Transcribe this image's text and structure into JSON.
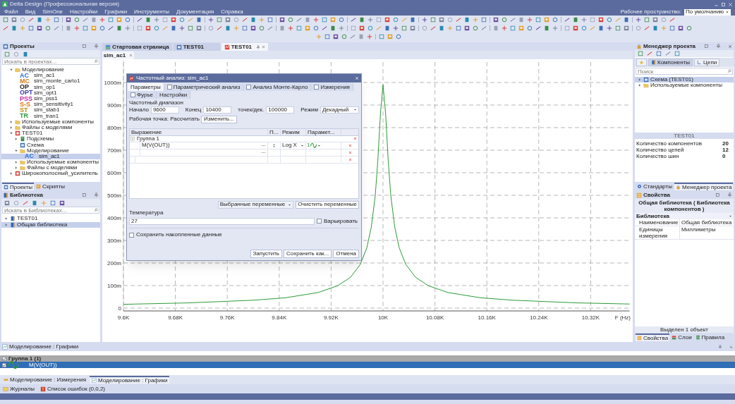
{
  "window": {
    "title": "Delta Design (Профессиональная версия)",
    "workspace_label": "Рабочее пространство:",
    "workspace_value": "По умолчанию"
  },
  "menu": [
    "Файл",
    "Вид",
    "SimOne",
    "Настройки",
    "Графики",
    "Инструменты",
    "Документация",
    "Справка"
  ],
  "projects_panel": {
    "title": "Проекты",
    "search_placeholder": "Искать в проектах...",
    "tree": [
      {
        "label": "Моделирование",
        "kind": "folder",
        "expanded": true,
        "selected": false,
        "children": [
          {
            "label": "sim_ac1",
            "kind": "sim",
            "badge": "AC",
            "color": "#2a6fd0",
            "selected": false
          },
          {
            "label": "sim_monte_carlo1",
            "kind": "sim",
            "badge": "MC",
            "color": "#d07a20",
            "selected": false
          },
          {
            "label": "sim_op1",
            "kind": "sim",
            "badge": "OP",
            "color": "#222222",
            "selected": false
          },
          {
            "label": "sim_opt1",
            "kind": "sim",
            "badge": "OPT",
            "color": "#3a3ab0",
            "selected": false
          },
          {
            "label": "sim_pss1",
            "kind": "sim",
            "badge": "PSS",
            "color": "#c02aa0",
            "selected": false
          },
          {
            "label": "sim_sensitivity1",
            "kind": "sim",
            "badge": "S-S",
            "color": "#e07010",
            "selected": false
          },
          {
            "label": "sim_stab1",
            "kind": "sim",
            "badge": "ST",
            "color": "#c08a10",
            "selected": false
          },
          {
            "label": "sim_tran1",
            "kind": "sim",
            "badge": "TR",
            "color": "#2a9a3a",
            "selected": false
          }
        ]
      },
      {
        "label": "Используемые компоненты",
        "kind": "folder",
        "expanded": false,
        "selected": false
      },
      {
        "label": "Файлы с моделями",
        "kind": "folder",
        "expanded": false,
        "selected": false
      },
      {
        "label": "TEST01",
        "kind": "project",
        "expanded": true,
        "selected": false,
        "children": [
          {
            "label": "Подсхемы",
            "kind": "subcircuit",
            "expanded": false,
            "selected": false
          },
          {
            "label": "Схема",
            "kind": "schematic",
            "selected": false
          },
          {
            "label": "Моделирование",
            "kind": "folder",
            "expanded": true,
            "selected": false,
            "children": [
              {
                "label": "sim_ac1",
                "kind": "sim",
                "badge": "AC",
                "color": "#2a6fd0",
                "selected": true
              }
            ]
          },
          {
            "label": "Используемые компоненты",
            "kind": "folder",
            "expanded": false,
            "selected": false
          },
          {
            "label": "Файлы с моделями",
            "kind": "folder",
            "expanded": false,
            "selected": false
          }
        ]
      },
      {
        "label": "Широкополосный_усилитель",
        "kind": "project",
        "expanded": false,
        "selected": false
      }
    ]
  },
  "left_tabs": [
    {
      "label": "Проекты",
      "kind": "projects",
      "selected": true
    },
    {
      "label": "Скрипты",
      "kind": "scripts",
      "selected": false
    }
  ],
  "library_panel": {
    "title": "Библиотека",
    "search_placeholder": "Искать в Библиотеках...",
    "items": [
      {
        "label": "TEST01",
        "selected": false
      },
      {
        "label": "Общая библиотека",
        "selected": true
      }
    ]
  },
  "document_tabs": [
    {
      "label": "Стартовая страница",
      "kind": "start",
      "selected": false
    },
    {
      "label": "TEST01",
      "kind": "schematic",
      "selected": false
    },
    {
      "label": "TEST01",
      "kind": "sim",
      "selected": true
    }
  ],
  "sub_tabs": [
    {
      "label": "sim_ac1",
      "selected": true
    }
  ],
  "chart": {
    "chart_data": {
      "type": "line",
      "xlabel": "F (Hz)",
      "x": [
        9600,
        9700,
        9800,
        9850,
        9900,
        9930,
        9950,
        9965,
        9975,
        9982,
        9988,
        9992,
        9996,
        10000,
        10004,
        10008,
        10012,
        10018,
        10025,
        10035,
        10050,
        10070,
        10100,
        10150,
        10200,
        10300,
        10380
      ],
      "series": [
        {
          "color": "#2e9a3a",
          "values": [
            17,
            23,
            35,
            46,
            69,
            99,
            137,
            194,
            267,
            359,
            499,
            652,
            860,
            990,
            860,
            652,
            499,
            359,
            267,
            194,
            137,
            99,
            69,
            46,
            35,
            23,
            18
          ]
        }
      ],
      "xlim": [
        9600,
        10380
      ],
      "ylim": [
        0,
        1100
      ],
      "grid": true,
      "xticks": [
        {
          "value": 9600,
          "label": "9.6K"
        },
        {
          "value": 9680,
          "label": "9.68K"
        },
        {
          "value": 9760,
          "label": "9.76K"
        },
        {
          "value": 9840,
          "label": "9.84K"
        },
        {
          "value": 9920,
          "label": "9.92K"
        },
        {
          "value": 10000,
          "label": "10K"
        },
        {
          "value": 10080,
          "label": "10.08K"
        },
        {
          "value": 10160,
          "label": "10.16K"
        },
        {
          "value": 10240,
          "label": "10.24K"
        },
        {
          "value": 10320,
          "label": "10.32K"
        }
      ],
      "yticks": [
        {
          "value": 0,
          "label": "0"
        },
        {
          "value": 100,
          "label": "100m"
        },
        {
          "value": 200,
          "label": "200m"
        },
        {
          "value": 300,
          "label": "300m"
        },
        {
          "value": 400,
          "label": "400m"
        },
        {
          "value": 500,
          "label": "500m"
        },
        {
          "value": 600,
          "label": "600m"
        },
        {
          "value": 700,
          "label": "700m"
        },
        {
          "value": 800,
          "label": "800m"
        },
        {
          "value": 900,
          "label": "900m"
        },
        {
          "value": 1000,
          "label": "1000m"
        }
      ]
    }
  },
  "dialog": {
    "title": "Частотный анализ: sim_ac1",
    "tabs": [
      {
        "label": "Параметры",
        "selected": true
      },
      {
        "label": "Параметрический анализ",
        "selected": false,
        "checked": false
      },
      {
        "label": "Анализ Монте-Карло",
        "selected": false,
        "checked": false
      },
      {
        "label": "Измерения",
        "selected": false,
        "checked": false
      },
      {
        "label": "Фурье",
        "selected": false,
        "checked": false
      },
      {
        "label": "Настройки",
        "selected": false
      }
    ],
    "range_label": "Частотный диапазон",
    "fields": [
      {
        "label": "Начало",
        "value": "9600"
      },
      {
        "label": "Конец",
        "value": "10400"
      },
      {
        "label": "точек/дек.",
        "value": "100000"
      }
    ],
    "mode": {
      "label": "Режим",
      "value": "Декадный"
    },
    "op_label": "Рабочая точка: Рассчитать",
    "op_button": "Изменить...",
    "columns": [
      "Выражение",
      "П...",
      "Режим",
      "Парамет..."
    ],
    "group": {
      "label": "Группа 1",
      "expanded": true
    },
    "rows": [
      {
        "kind": "signal",
        "expression": "M(V(OUT))",
        "mode": "Log X",
        "param": "1"
      },
      {
        "kind": "blank-signal"
      },
      {
        "kind": "blank-group"
      }
    ],
    "vars_dropdown": "Выбранные переменные",
    "clear_button": "Очистить переменные",
    "temperature": {
      "label": "Температура",
      "value": "27",
      "vary_label": "Варьировать",
      "vary_checked": false
    },
    "save_data": {
      "label": "Сохранить накопленные данные",
      "checked": false
    },
    "buttons": [
      "Запустить",
      "Сохранить как...",
      "Отмена"
    ]
  },
  "project_manager": {
    "title": "Менеджер проекта",
    "tabs": [
      {
        "kind": "favorites",
        "selected": false
      },
      {
        "kind": "components",
        "label": "Компоненты",
        "selected": true
      },
      {
        "kind": "nets",
        "label": "Цепи",
        "selected": false
      }
    ],
    "search_placeholder": "Поиск",
    "tree": [
      {
        "label": "Схема (TEST01)",
        "kind": "schematic",
        "expanded": false,
        "selected": true
      },
      {
        "label": "Используемые компоненты",
        "kind": "folder",
        "expanded": false,
        "selected": false
      }
    ],
    "stats_title": "TEST01",
    "stats": [
      {
        "label": "Количество компонентов",
        "value": "20"
      },
      {
        "label": "Количество цепей",
        "value": "12"
      },
      {
        "label": "Количество шин",
        "value": "0"
      }
    ]
  },
  "right_tabs": [
    {
      "label": "Стандарты",
      "kind": "standards",
      "selected": false
    },
    {
      "label": "Менеджер проекта",
      "kind": "manager",
      "selected": true
    }
  ],
  "properties": {
    "title": "Свойства",
    "object": "Общая библиотека ( Библиотека компонентов )",
    "section": "Библиотека",
    "rows": [
      {
        "name": "Наименование",
        "value": "Общая библиотека"
      },
      {
        "name": "Единицы измерения",
        "value": "Миллиметры"
      }
    ],
    "footer": "Выделен 1 объект"
  },
  "properties_tabs": [
    {
      "label": "Свойства",
      "kind": "properties",
      "selected": true
    },
    {
      "label": "Слои",
      "kind": "layers",
      "selected": false
    },
    {
      "label": "Правила",
      "kind": "rules",
      "selected": false
    }
  ],
  "graphs_panel": {
    "title": "Моделирование : Графики",
    "group": {
      "label": "Группа 1 (1)",
      "checked": true
    },
    "rows": [
      {
        "label": "M(V(OUT))",
        "checked": true,
        "selected": true
      }
    ]
  },
  "bottom_tabs": [
    {
      "label": "Моделирование : Измерения",
      "selected": false
    },
    {
      "label": "Моделирование : Графики",
      "selected": true
    }
  ],
  "status_items": [
    {
      "label": "Журналы",
      "kind": "log"
    },
    {
      "label": "Список ошибок (0,0,2)",
      "kind": "errors"
    }
  ]
}
